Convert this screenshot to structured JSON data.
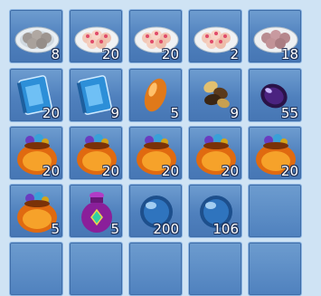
{
  "inventory": {
    "slots": [
      {
        "item": "plate-of-gray-dumplings-icon",
        "count": "8"
      },
      {
        "item": "plate-of-pink-dumplings-icon",
        "count": "20"
      },
      {
        "item": "plate-of-pink-dumplings-icon",
        "count": "20"
      },
      {
        "item": "plate-of-pink-dumplings-icon",
        "count": "2"
      },
      {
        "item": "plate-of-mauve-dumplings-icon",
        "count": "18"
      },
      {
        "item": "blue-book-icon",
        "count": "20"
      },
      {
        "item": "blue-book-icon",
        "count": "9"
      },
      {
        "item": "amber-gem-icon",
        "count": "5"
      },
      {
        "item": "seeds-pile-icon",
        "count": "9"
      },
      {
        "item": "purple-orb-icon",
        "count": "55"
      },
      {
        "item": "fire-treasure-bag-icon",
        "count": "20"
      },
      {
        "item": "fire-treasure-bag-icon",
        "count": "20"
      },
      {
        "item": "fire-treasure-bag-icon",
        "count": "20"
      },
      {
        "item": "fire-treasure-bag-icon",
        "count": "20"
      },
      {
        "item": "fire-treasure-bag-icon",
        "count": "20"
      },
      {
        "item": "fire-treasure-bag-icon",
        "count": "5"
      },
      {
        "item": "purple-pouch-icon",
        "count": "5"
      },
      {
        "item": "blue-crystal-ball-icon",
        "count": "200"
      },
      {
        "item": "blue-crystal-ball-icon",
        "count": "106"
      },
      {
        "item": "",
        "count": ""
      },
      {
        "item": "",
        "count": ""
      },
      {
        "item": "",
        "count": ""
      },
      {
        "item": "",
        "count": ""
      },
      {
        "item": "",
        "count": ""
      },
      {
        "item": "",
        "count": ""
      }
    ]
  }
}
